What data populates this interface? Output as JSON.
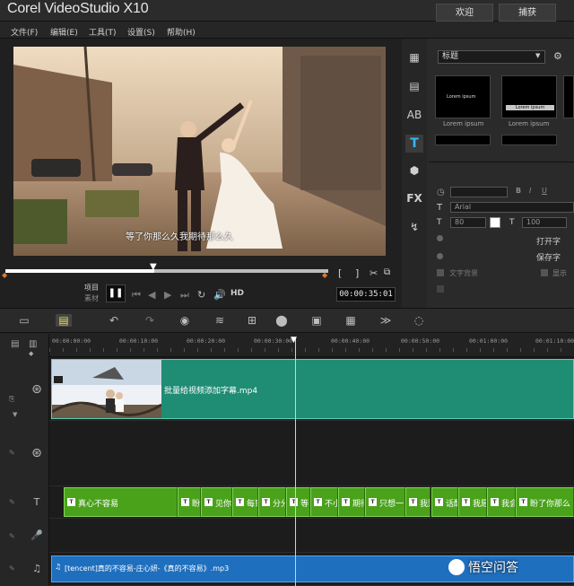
{
  "app": {
    "title": "Corel VideoStudio X10",
    "tabs": [
      "欢迎",
      "捕获"
    ]
  },
  "menu": [
    "文件(F)",
    "编辑(E)",
    "工具(T)",
    "设置(S)",
    "帮助(H)"
  ],
  "player": {
    "subtitle": "等了你那么久我期待那么久",
    "project_label": "项目",
    "clip_label": "素材",
    "timecode": "00:00:35:01",
    "hd_label": "HD",
    "progress_fraction": 0.46
  },
  "right_panel": {
    "category_dropdown": "标题",
    "thumb_captions": [
      "Lorem ipsum",
      "Lorem ipsum"
    ],
    "thumb_titles": [
      "Lorem ipsum",
      "Lorem ipsum"
    ],
    "font_name": "Arial",
    "font_size_a": "80",
    "font_size_b": "100",
    "open_label": "打开字",
    "save_label": "保存字",
    "text_bg_label": "文字背景",
    "show_label": "显示"
  },
  "ruler": {
    "ticks": [
      "00:00:00:00",
      "00:00:10:00",
      "00:00:20:00",
      "00:00:30:00",
      "00:00:40:00",
      "00:00:50:00",
      "00:01:00:00",
      "00:01:10:00"
    ]
  },
  "tracks": {
    "video_clip_label": "批量给视频添加字幕.mp4",
    "title_clips": [
      "真心不容易",
      "盼",
      "见你",
      "每到",
      "分分",
      "等",
      "不小",
      "期待",
      "只想一",
      "我别",
      "话醒",
      "我愿",
      "我会",
      "盼了你那么"
    ],
    "music_clip_label": "[tencent]真的不容易-庄心妍-《真的不容易》.mp3"
  },
  "watermark": "悟空问答"
}
